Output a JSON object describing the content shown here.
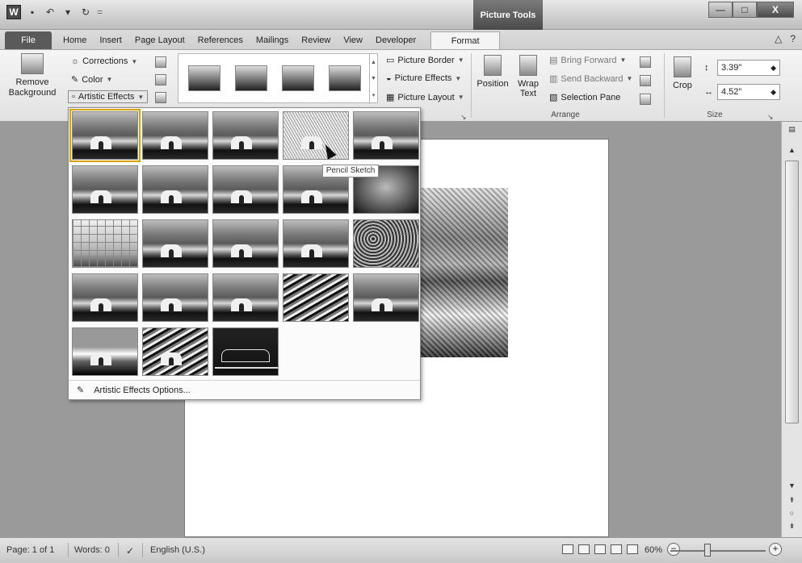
{
  "qat": {
    "app_letter": "W",
    "save": "▪",
    "undo": "↶",
    "undo_caret": "▾",
    "redo": "↻",
    "customize": "="
  },
  "context_tab": "Picture Tools",
  "window": {
    "min": "—",
    "max": "□",
    "close": "X"
  },
  "tabs": [
    "File",
    "Home",
    "Insert",
    "Page Layout",
    "References",
    "Mailings",
    "Review",
    "View",
    "Developer"
  ],
  "active_tab": "Format",
  "help_icons": {
    "minimize_ribbon": "△",
    "help": "?"
  },
  "ribbon": {
    "remove_background": "Remove Background",
    "corrections": "Corrections",
    "color": "Color",
    "artistic_effects": "Artistic Effects",
    "picture_border": "Picture Border",
    "picture_effects": "Picture Effects",
    "picture_layout": "Picture Layout",
    "position": "Position",
    "wrap_text": "Wrap Text",
    "bring_forward": "Bring Forward",
    "send_backward": "Send Backward",
    "selection_pane": "Selection Pane",
    "arrange_label": "Arrange",
    "crop": "Crop",
    "height": "3.39\"",
    "width": "4.52\"",
    "size_label": "Size",
    "dialog_launcher": "↘"
  },
  "dropdown": {
    "tooltip": "Pencil Sketch",
    "options_label": "Artistic Effects Options..."
  },
  "statusbar": {
    "page": "Page: 1 of 1",
    "words": "Words: 0",
    "language": "English (U.S.)",
    "zoom": "60%",
    "zoom_out": "−",
    "zoom_in": "+"
  },
  "scrollbar": {
    "up": "▲",
    "down": "▼",
    "prev_page": "⇞",
    "browse": "○",
    "next_page": "⇟"
  },
  "colors": {
    "accent_tab": "#5a5a5a",
    "selected_outline": "#d9a400"
  }
}
